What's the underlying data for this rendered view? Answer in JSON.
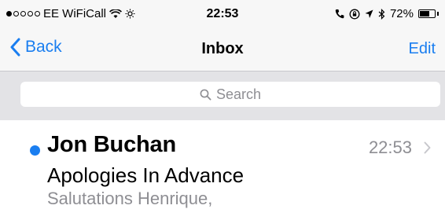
{
  "status_bar": {
    "carrier": "EE WiFiCall",
    "time": "22:53",
    "battery": "72%",
    "battery_level": 0.72,
    "signal_bars_filled": 1,
    "signal_bars_total": 5,
    "icons": [
      "wifi-icon",
      "brightness-icon",
      "call-icon",
      "lock-rotation-icon",
      "location-icon",
      "bluetooth-icon",
      "battery-icon"
    ]
  },
  "nav": {
    "back_label": "Back",
    "title": "Inbox",
    "edit_label": "Edit"
  },
  "search": {
    "placeholder": "Search"
  },
  "messages": [
    {
      "unread": true,
      "sender": "Jon Buchan",
      "time": "22:53",
      "subject": "Apologies In Advance",
      "preview": "Salutations Henrique,"
    }
  ],
  "colors": {
    "accent": "#1a7ef0",
    "secondary_text": "#8e8e93",
    "search_background": "#e3e3e6",
    "bar_background": "#f7f7f7"
  }
}
